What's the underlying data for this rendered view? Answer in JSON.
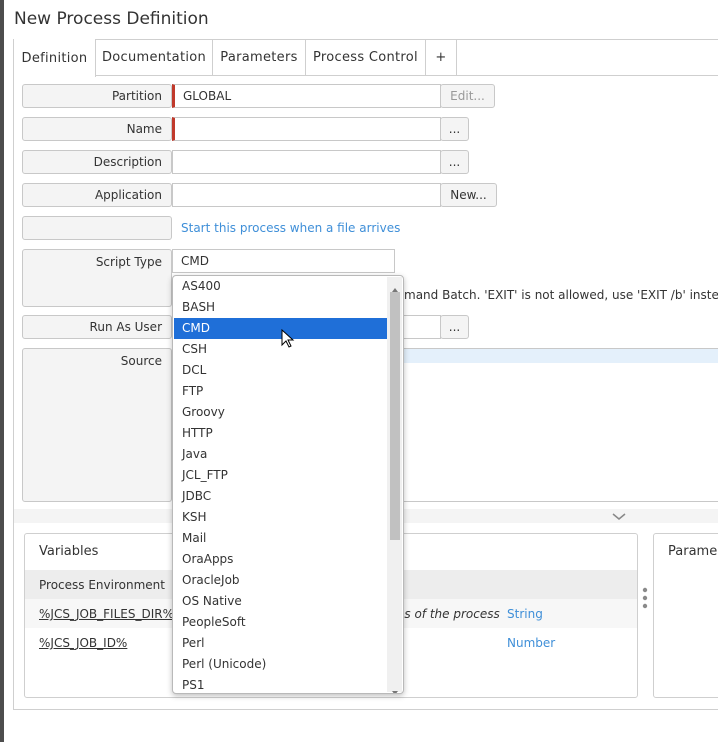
{
  "window": {
    "title": "New Process Definition"
  },
  "tabs": [
    {
      "label": "Definition"
    },
    {
      "label": "Documentation"
    },
    {
      "label": "Parameters"
    },
    {
      "label": "Process Control"
    },
    {
      "label": "+"
    }
  ],
  "form": {
    "partition": {
      "label": "Partition",
      "value": "GLOBAL",
      "button": "Edit..."
    },
    "name": {
      "label": "Name",
      "value": "",
      "button": "..."
    },
    "description": {
      "label": "Description",
      "value": "",
      "button": "..."
    },
    "application": {
      "label": "Application",
      "value": "",
      "button": "New..."
    },
    "file_arrival_link": "Start this process when a file arrives",
    "script_type": {
      "label": "Script Type",
      "value": "CMD",
      "hint": "mand Batch. 'EXIT' is not allowed, use 'EXIT /b' instead. Se"
    },
    "run_as_user": {
      "label": "Run As User",
      "value": "",
      "button": "..."
    },
    "source": {
      "label": "Source"
    }
  },
  "variables": {
    "title": "Variables",
    "group": "Process Environment",
    "rows": [
      {
        "name": "%JCS_JOB_FILES_DIR%",
        "desc": "es of the process",
        "type": "String"
      },
      {
        "name": "%JCS_JOB_ID%",
        "desc": "",
        "type": "Number"
      }
    ]
  },
  "parameters_panel": {
    "title": "Parame"
  },
  "dropdown": {
    "selected": "CMD",
    "options": [
      "AS400",
      "BASH",
      "CMD",
      "CSH",
      "DCL",
      "FTP",
      "Groovy",
      "HTTP",
      "Java",
      "JCL_FTP",
      "JDBC",
      "KSH",
      "Mail",
      "OraApps",
      "OracleJob",
      "OS Native",
      "PeopleSoft",
      "Perl",
      "Perl (Unicode)",
      "PS1"
    ]
  },
  "colors": {
    "accent": "#1f6fd8",
    "link": "#3f8fd8",
    "required": "#c0392b"
  }
}
